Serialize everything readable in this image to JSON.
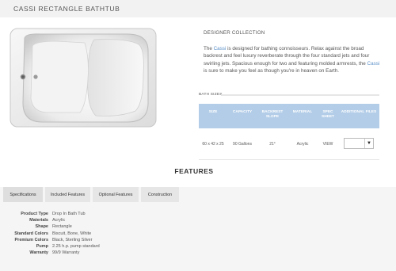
{
  "page": {
    "title": "CASSI RECTANGLE BATHTUB"
  },
  "product": {
    "image_icon": "bathtub-top-view",
    "collection": "DESIGNER COLLECTION",
    "description_parts": [
      "The ",
      "Cassi",
      " is designed for bathing connoisseurs. Relax against the broad backrest and feel luxury reverberate through the four standard jets and four swirling jets. Spacious enough for two and featuring molded armrests, the ",
      "Cassi",
      " is sure to make you feel as though you're in heaven on Earth."
    ],
    "highlight_color": "#5a8fc7"
  },
  "bath_sizes": {
    "label": "BATH SIZES",
    "headers": [
      "SIZE",
      "CAPACITY",
      "BACKREST SLOPE",
      "MATERIAL",
      "SPEC SHEET",
      "ADDITIONAL FILES"
    ],
    "row": {
      "size": "60 x 42 x 25",
      "capacity": "90 Gallons",
      "backrest_slope": "21°",
      "material": "Acrylic",
      "spec_sheet": "VIEW",
      "files_value": ""
    },
    "header_color": "#b3cde8"
  },
  "features": {
    "title": "FEATURES",
    "tabs": [
      "Specifications",
      "Included Features",
      "Optional Features",
      "Construction"
    ],
    "active_tab": "Specifications",
    "specs": [
      {
        "key": "Product Type",
        "value": "Drop In Bath Tub"
      },
      {
        "key": "Materials",
        "value": "Acrylic"
      },
      {
        "key": "Shape",
        "value": "Rectangle"
      },
      {
        "key": "Standard Colors",
        "value": "Biscuit, Bone, White"
      },
      {
        "key": "Premium Colors",
        "value": "Black, Sterling Silver"
      },
      {
        "key": "Pump",
        "value": "2.25 h.p. pump standard"
      },
      {
        "key": "Warranty",
        "value": "99/9 Warranty"
      }
    ]
  }
}
